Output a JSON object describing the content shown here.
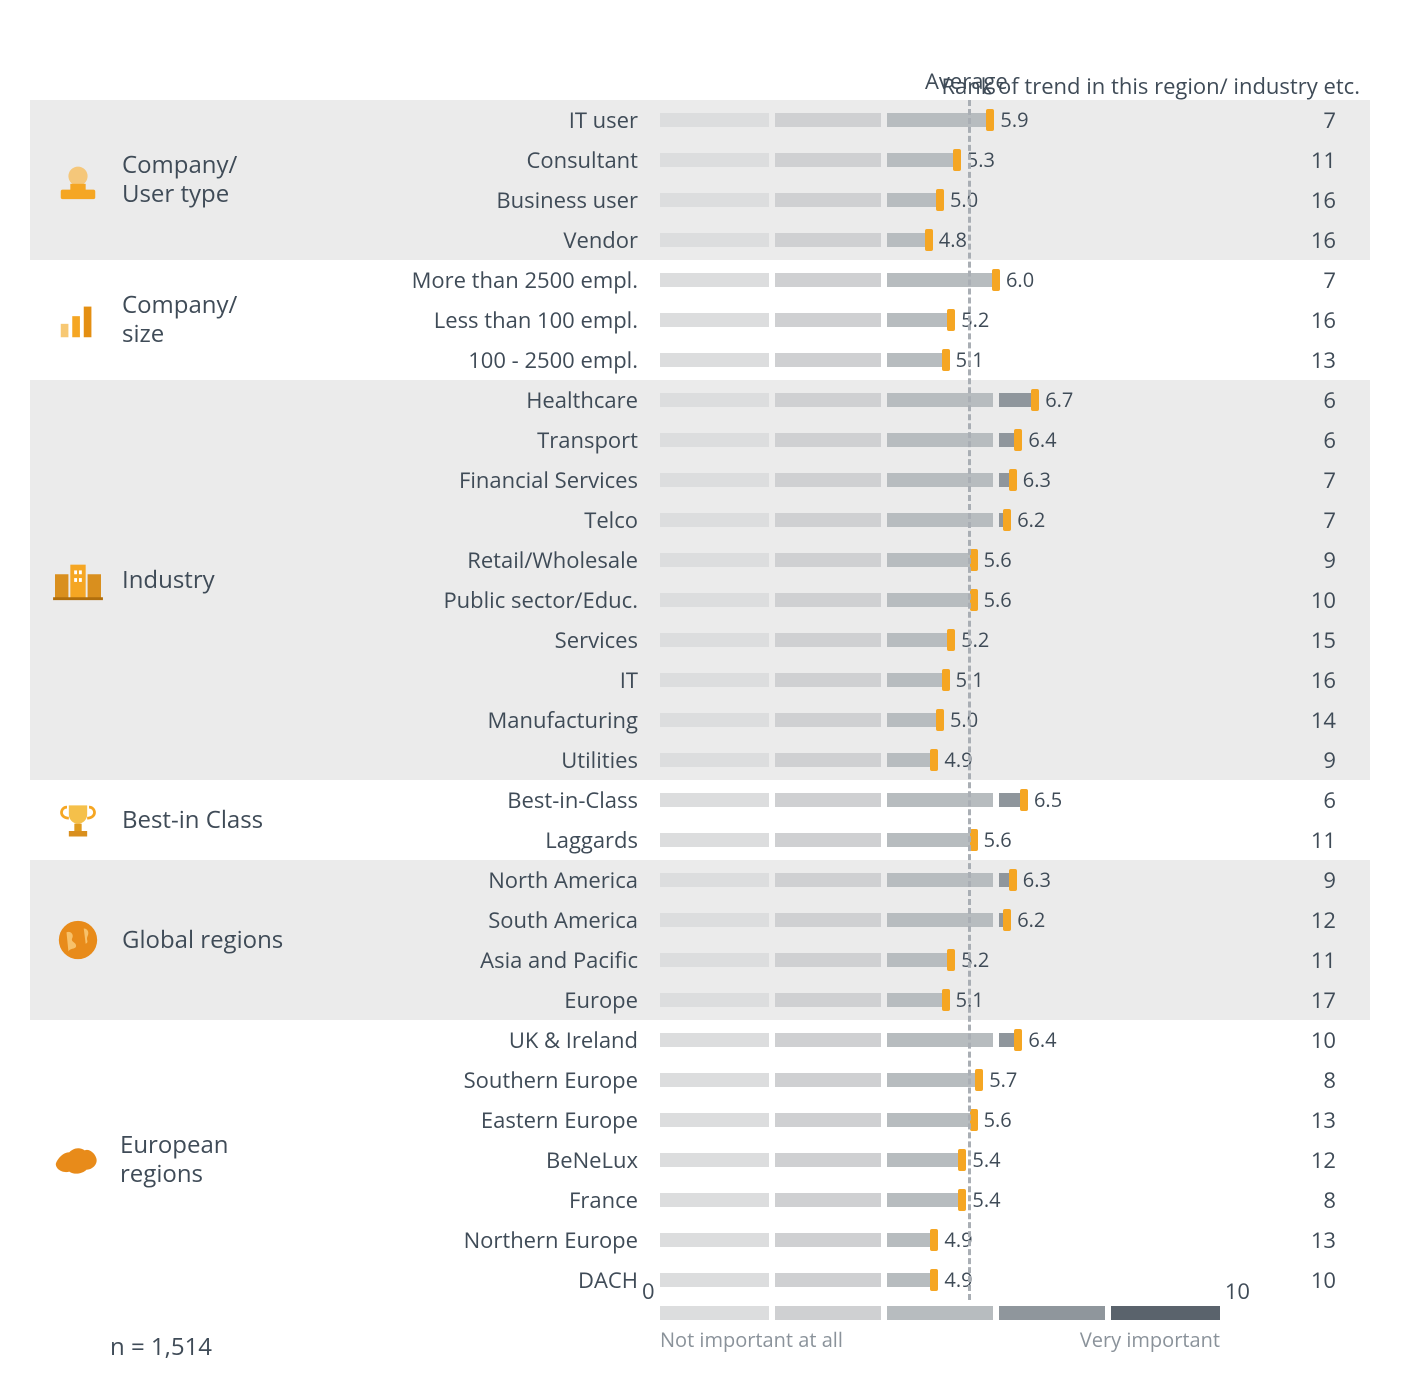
{
  "header": {
    "average_label": "Average",
    "rank_label": "Rank of trend in this region/ industry etc."
  },
  "axis": {
    "min_label": "0",
    "max_label": "10",
    "left_caption": "Not important at all",
    "right_caption": "Very important",
    "average_value": 5.5
  },
  "footer": {
    "n_label": "n = 1,514"
  },
  "groups": [
    {
      "title": "Company/ User type",
      "icon": "user-icon",
      "shaded": true,
      "rows": [
        {
          "label": "IT user",
          "value": 5.9,
          "rank": 7
        },
        {
          "label": "Consultant",
          "value": 5.3,
          "rank": 11
        },
        {
          "label": "Business user",
          "value": 5.0,
          "rank": 16
        },
        {
          "label": "Vendor",
          "value": 4.8,
          "rank": 16
        }
      ]
    },
    {
      "title": "Company/ size",
      "icon": "bars-icon",
      "shaded": false,
      "rows": [
        {
          "label": "More than 2500 empl.",
          "value": 6.0,
          "rank": 7
        },
        {
          "label": "Less than 100 empl.",
          "value": 5.2,
          "rank": 16
        },
        {
          "label": "100 - 2500 empl.",
          "value": 5.1,
          "rank": 13
        }
      ]
    },
    {
      "title": "Industry",
      "icon": "building-icon",
      "shaded": true,
      "rows": [
        {
          "label": "Healthcare",
          "value": 6.7,
          "rank": 6
        },
        {
          "label": "Transport",
          "value": 6.4,
          "rank": 6
        },
        {
          "label": "Financial Services",
          "value": 6.3,
          "rank": 7
        },
        {
          "label": "Telco",
          "value": 6.2,
          "rank": 7
        },
        {
          "label": "Retail/Wholesale",
          "value": 5.6,
          "rank": 9
        },
        {
          "label": "Public sector/Educ.",
          "value": 5.6,
          "rank": 10
        },
        {
          "label": "Services",
          "value": 5.2,
          "rank": 15
        },
        {
          "label": "IT",
          "value": 5.1,
          "rank": 16
        },
        {
          "label": "Manufacturing",
          "value": 5.0,
          "rank": 14
        },
        {
          "label": "Utilities",
          "value": 4.9,
          "rank": 9
        }
      ]
    },
    {
      "title": "Best-in Class",
      "icon": "trophy-icon",
      "shaded": false,
      "rows": [
        {
          "label": "Best-in-Class",
          "value": 6.5,
          "rank": 6
        },
        {
          "label": "Laggards",
          "value": 5.6,
          "rank": 11
        }
      ]
    },
    {
      "title": "Global regions",
      "icon": "globe-icon",
      "shaded": true,
      "rows": [
        {
          "label": "North America",
          "value": 6.3,
          "rank": 9
        },
        {
          "label": "South America",
          "value": 6.2,
          "rank": 12
        },
        {
          "label": "Asia and Pacific",
          "value": 5.2,
          "rank": 11
        },
        {
          "label": "Europe",
          "value": 5.1,
          "rank": 17
        }
      ]
    },
    {
      "title": "European regions",
      "icon": "europe-icon",
      "shaded": false,
      "rows": [
        {
          "label": "UK & Ireland",
          "value": 6.4,
          "rank": 10
        },
        {
          "label": "Southern Europe",
          "value": 5.7,
          "rank": 8
        },
        {
          "label": "Eastern Europe",
          "value": 5.6,
          "rank": 13
        },
        {
          "label": "BeNeLux",
          "value": 5.4,
          "rank": 12
        },
        {
          "label": "France",
          "value": 5.4,
          "rank": 8
        },
        {
          "label": "Northern Europe",
          "value": 4.9,
          "rank": 13
        },
        {
          "label": "DACH",
          "value": 4.9,
          "rank": 10
        }
      ]
    }
  ],
  "chart_data": {
    "type": "bar",
    "xlabel": "",
    "ylabel": "",
    "xlim": [
      0,
      10
    ],
    "average_line": 5.5,
    "left_caption": "Not important at all",
    "right_caption": "Very important",
    "series": [
      {
        "group": "Company/ User type",
        "name": "IT user",
        "value": 5.9,
        "rank": 7
      },
      {
        "group": "Company/ User type",
        "name": "Consultant",
        "value": 5.3,
        "rank": 11
      },
      {
        "group": "Company/ User type",
        "name": "Business user",
        "value": 5.0,
        "rank": 16
      },
      {
        "group": "Company/ User type",
        "name": "Vendor",
        "value": 4.8,
        "rank": 16
      },
      {
        "group": "Company/ size",
        "name": "More than 2500 empl.",
        "value": 6.0,
        "rank": 7
      },
      {
        "group": "Company/ size",
        "name": "Less than 100 empl.",
        "value": 5.2,
        "rank": 16
      },
      {
        "group": "Company/ size",
        "name": "100 - 2500 empl.",
        "value": 5.1,
        "rank": 13
      },
      {
        "group": "Industry",
        "name": "Healthcare",
        "value": 6.7,
        "rank": 6
      },
      {
        "group": "Industry",
        "name": "Transport",
        "value": 6.4,
        "rank": 6
      },
      {
        "group": "Industry",
        "name": "Financial Services",
        "value": 6.3,
        "rank": 7
      },
      {
        "group": "Industry",
        "name": "Telco",
        "value": 6.2,
        "rank": 7
      },
      {
        "group": "Industry",
        "name": "Retail/Wholesale",
        "value": 5.6,
        "rank": 9
      },
      {
        "group": "Industry",
        "name": "Public sector/Educ.",
        "value": 5.6,
        "rank": 10
      },
      {
        "group": "Industry",
        "name": "Services",
        "value": 5.2,
        "rank": 15
      },
      {
        "group": "Industry",
        "name": "IT",
        "value": 5.1,
        "rank": 16
      },
      {
        "group": "Industry",
        "name": "Manufacturing",
        "value": 5.0,
        "rank": 14
      },
      {
        "group": "Industry",
        "name": "Utilities",
        "value": 4.9,
        "rank": 9
      },
      {
        "group": "Best-in Class",
        "name": "Best-in-Class",
        "value": 6.5,
        "rank": 6
      },
      {
        "group": "Best-in Class",
        "name": "Laggards",
        "value": 5.6,
        "rank": 11
      },
      {
        "group": "Global regions",
        "name": "North America",
        "value": 6.3,
        "rank": 9
      },
      {
        "group": "Global regions",
        "name": "South America",
        "value": 6.2,
        "rank": 12
      },
      {
        "group": "Global regions",
        "name": "Asia and Pacific",
        "value": 5.2,
        "rank": 11
      },
      {
        "group": "Global regions",
        "name": "Europe",
        "value": 5.1,
        "rank": 17
      },
      {
        "group": "European regions",
        "name": "UK & Ireland",
        "value": 6.4,
        "rank": 10
      },
      {
        "group": "European regions",
        "name": "Southern Europe",
        "value": 5.7,
        "rank": 8
      },
      {
        "group": "European regions",
        "name": "Eastern Europe",
        "value": 5.6,
        "rank": 13
      },
      {
        "group": "European regions",
        "name": "BeNeLux",
        "value": 5.4,
        "rank": 12
      },
      {
        "group": "European regions",
        "name": "France",
        "value": 5.4,
        "rank": 8
      },
      {
        "group": "European regions",
        "name": "Northern Europe",
        "value": 4.9,
        "rank": 13
      },
      {
        "group": "European regions",
        "name": "DACH",
        "value": 4.9,
        "rank": 10
      }
    ]
  }
}
